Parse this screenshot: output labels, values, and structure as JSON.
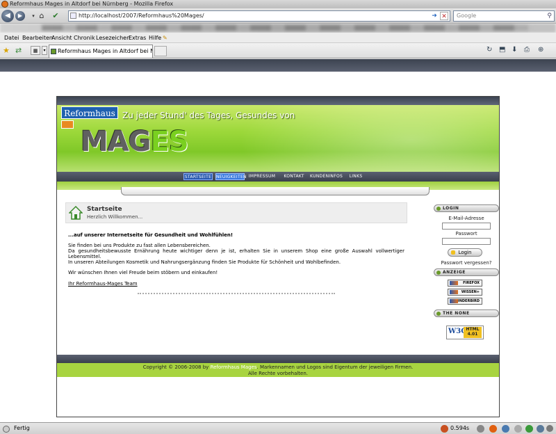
{
  "window": {
    "title": "Reformhaus Mages in Altdorf bei Nürnberg - Mozilla Firefox"
  },
  "browser": {
    "url": "http://localhost/2007/Reformhaus%20Mages/",
    "search_placeholder": "Google",
    "menu": [
      "Datei",
      "Bearbeiten",
      "Ansicht",
      "Chronik",
      "Lesezeichen",
      "Extras",
      "Hilfe"
    ],
    "tab_title": "Reformhaus Mages in Altdorf bei Nürnb...",
    "status": "Fertig",
    "load_time": "0.594s"
  },
  "site": {
    "logo_top": "Reformhaus",
    "logo_main_a": "MAG",
    "logo_main_b": "ES",
    "slogan": "Zu jeder Stund' des Tages, Gesundes von",
    "nav": [
      "STARTSEITE",
      "NEUIGKEITEN",
      "IMPRESSUM",
      "KONTAKT",
      "KUNDENINFOS",
      "LINKS"
    ],
    "page_title": "Startseite",
    "page_subtitle": "Herzlich Willkommen...",
    "intro_bold": "...auf unserer Internetseite für Gesundheit und Wohlfühlen!",
    "para1": "Sie finden bei uns Produkte zu fast allen Lebensbereichen.",
    "para2": "Da gesundheitsbewusste Ernährung heute wichtiger denn je ist, erhalten Sie in unserem Shop eine große Auswahl vollwertiger Lebensmittel.",
    "para3": "In unseren Abteilungen Kosmetik und Nahrungsergänzung finden Sie Produkte für Schönheit und Wohlbefinden.",
    "para4": "Wir wünschen Ihnen viel Freude beim stöbern und einkaufen!",
    "team_link": "Ihr Reformhaus-Mages Team",
    "sidebar": {
      "login_head": "LOGIN",
      "email_label": "E-Mail-Adresse",
      "password_label": "Passwort",
      "login_button": "Login",
      "forgot": "Passwort vergessen?",
      "ads_head": "ANZEIGE",
      "badges": [
        "FIREFOX",
        "WISSEN+",
        "THUNDERBIRD"
      ],
      "none_head": "THE NONE",
      "w3c_left": "W3C",
      "w3c_right": "HTML 4.01"
    },
    "footer_pre": "Copyright © 2006-2008 by",
    "footer_link": "Reformhaus Mages",
    "footer_post": ". Markennamen und Logos sind Eigentum der jeweiligen Firmen.",
    "footer_line2": "Alle Rechte vorbehalten."
  }
}
